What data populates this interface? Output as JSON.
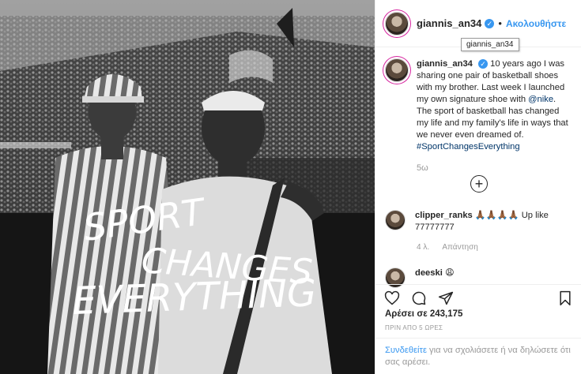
{
  "post": {
    "username": "giannis_an34",
    "follow_label": "Ακολουθήστε",
    "tooltip": "giannis_an34",
    "overlay_lines": [
      "SPORT",
      "CHANGES",
      "EVERYTHING"
    ],
    "caption": {
      "username": "giannis_an34",
      "text_part1": "10 years ago I was sharing one pair of basketball shoes with my brother.  Last week I launched my own signature shoe with ",
      "mention": "@nike",
      "text_part2": ". The sport of basketball has changed my life and my family's life in ways that we never even dreamed of. ",
      "hashtag": "#SportChangesEverything",
      "time": "5ω"
    },
    "comments": [
      {
        "username": "clipper_ranks",
        "text": "🙏🏾🙏🏾🙏🏾🙏🏾 Up like 77777777",
        "time": "4 λ.",
        "reply_label": "Απάντηση"
      },
      {
        "username": "deeski",
        "text": "😩"
      }
    ],
    "likes_label": "Αρέσει σε 243,175",
    "posted_label": "ΠΡΙΝ ΑΠΟ 5 ΩΡΕΣ",
    "login": {
      "link": "Συνδεθείτε",
      "rest": " για να σχολιάσετε ή να δηλώσετε ότι σας αρέσει."
    }
  },
  "icons": {
    "verified": "verified-badge-icon",
    "heart": "heart-icon",
    "comment": "comment-icon",
    "share": "share-icon",
    "bookmark": "bookmark-icon",
    "load_more": "plus-circle-icon"
  },
  "colors": {
    "link": "#3897f0",
    "text": "#262626",
    "muted": "#999999",
    "border": "#efefef"
  }
}
